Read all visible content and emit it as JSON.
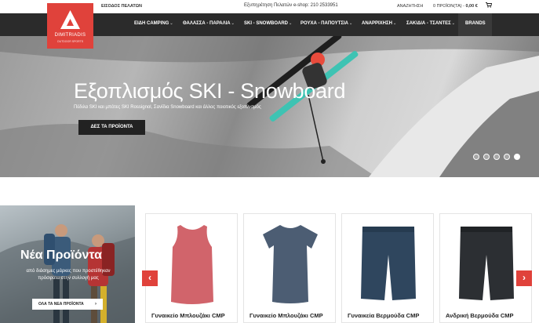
{
  "topbar": {
    "login": "ΕΙΣΟΔΟΣ ΠΕΛΑΤΩΝ",
    "support": "Εξυπηρέτηση Πελατών e-shop: 210 2533951",
    "search": "ΑΝΑΖΗΤΗΣΗ",
    "cart_count": "0 ΠΡΟΪΟΝ(ΤΑ) -",
    "cart_total": "0,00 €"
  },
  "logo": {
    "brand": "DIMITRIADIS",
    "tagline": "OUTDOOR SPORTS"
  },
  "nav": [
    {
      "label": "ΕΙΔΗ CAMPING"
    },
    {
      "label": "ΘΑΛΑΣΣΑ - ΠΑΡΑΛΙΑ"
    },
    {
      "label": "SKI - SNOWBOARD"
    },
    {
      "label": "ΡΟΥΧΑ - ΠΑΠΟΥΤΣΙΑ"
    },
    {
      "label": "ΑΝΑΡΡΙΧΗΣΗ"
    },
    {
      "label": "ΣΑΚΙΔΙΑ - ΤΣΑΝΤΕΣ"
    }
  ],
  "nav_brands": "BRANDS",
  "hero": {
    "title": "Εξοπλισμός SKI - Snowboard",
    "subtitle": "Πέδιλα SKI και μπότες SKI Rossignol, Σανίδια Snowboard και άλλος ποιοτικός εξοπλισμός",
    "button": "ΔΕΣ ΤΑ ΠΡΟΪΟΝΤΑ",
    "slides": 5,
    "active_slide": 5
  },
  "promo": {
    "title": "Νέα Προϊόντα",
    "subtitle": "από διάσημες μάρκες που προστέθηκαν πρόσφατα στην συλλογή μας",
    "button": "ΟΛΑ ΤΑ ΝΕΑ ΠΡΟΪΟΝΤΑ"
  },
  "products": [
    {
      "name": "Γυναικείο Μπλουζάκι CMP",
      "color": "#d1646b"
    },
    {
      "name": "Γυναικείο Μπλουζάκι CMP",
      "color": "#4c5d73"
    },
    {
      "name": "Γυναικεία Βερμούδα CMP",
      "color": "#2f465e"
    },
    {
      "name": "Ανδρική Βερμούδα CMP",
      "color": "#2c2f33"
    }
  ],
  "colors": {
    "accent": "#e0423b",
    "nav_bg": "#2b2b2b"
  },
  "icons": {
    "cart": "cart-icon",
    "prev": "chevron-left-icon",
    "next": "chevron-right-icon"
  }
}
